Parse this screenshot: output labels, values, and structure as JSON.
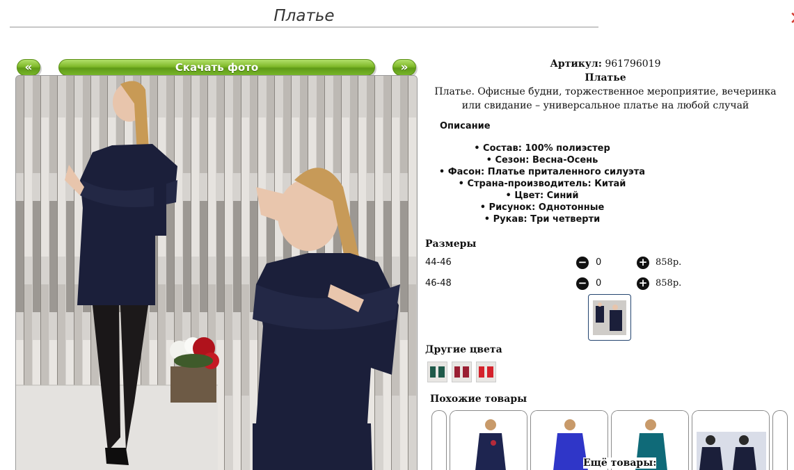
{
  "page": {
    "title": "Платье"
  },
  "nav": {
    "prev_label": "«",
    "download_label": "Скачать фото",
    "next_label": "»"
  },
  "product": {
    "article_label": "Артикул:",
    "article": "961796019",
    "name": "Платье",
    "summary": "Платье. Офисные будни, торжественное мероприятие, вечеринка или свидание – универсальное платье на любой случай"
  },
  "description": {
    "heading": "Описание",
    "specs": [
      "Состав: 100% полиэстер",
      "Сезон: Весна-Осень",
      "Фасон: Платье приталенного силуэта",
      "Страна-производитель: Китай",
      "Цвет: Синий",
      "Рисунок: Однотонные",
      "Рукав: Три четверти"
    ]
  },
  "sizes": {
    "heading": "Размеры",
    "rows": [
      {
        "size": "44-46",
        "qty": "0",
        "price": "858р."
      },
      {
        "size": "46-48",
        "qty": "0",
        "price": "858р."
      }
    ]
  },
  "other_colors": {
    "heading": "Другие цвета",
    "swatches": [
      "#1f5a4a",
      "#9a1f33",
      "#d4222c"
    ]
  },
  "similar": {
    "heading": "Похожие товары",
    "more_label": "Ещё товары:"
  },
  "colors": {
    "accent_green": "#7fb929",
    "dress_navy": "#1b1f3a",
    "close_red": "#d43a2f"
  }
}
